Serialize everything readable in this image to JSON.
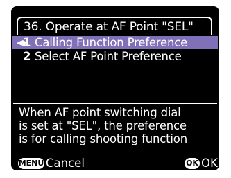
{
  "header": {
    "title": "36. Operate at AF Point \"SEL\""
  },
  "menu": {
    "items": [
      {
        "number": "1",
        "label": "Calling Function Preference",
        "selected": true
      },
      {
        "number": "2",
        "label": "Select AF Point Preference",
        "selected": false
      }
    ],
    "selected_arrow_icon": "left-right-arrow-icon"
  },
  "description": {
    "lines": [
      "When AF point switching dial",
      "is set at \"SEL\", the preference",
      "is for calling shooting function"
    ]
  },
  "footer": {
    "menu_badge": "MENU",
    "cancel_label": "Cancel",
    "ok_badge": "OK",
    "ok_label": "OK"
  },
  "colors": {
    "background": "#000000",
    "highlight": "#8070b8",
    "text": "#ffffff"
  }
}
